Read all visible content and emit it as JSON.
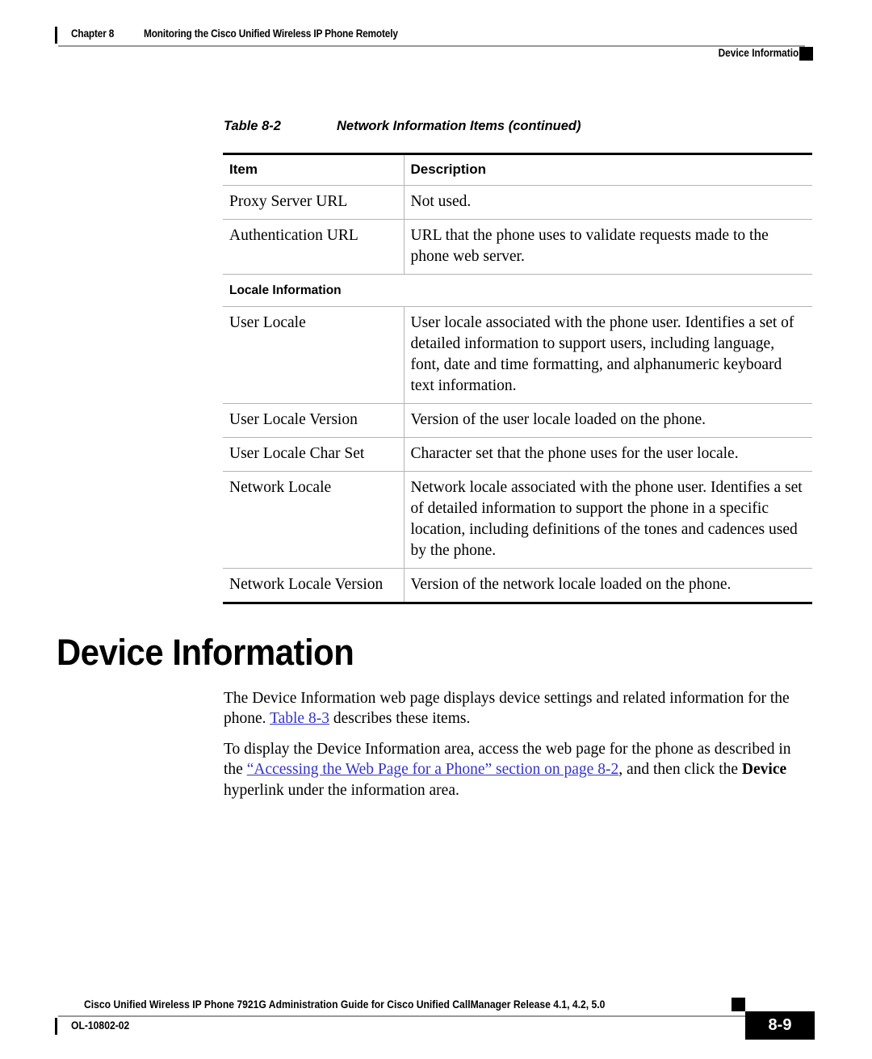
{
  "header": {
    "chapter_label": "Chapter 8",
    "chapter_title": "Monitoring the Cisco Unified Wireless IP Phone Remotely",
    "section_title": "Device Information"
  },
  "table": {
    "caption_number": "Table 8-2",
    "caption_title": "Network Information Items (continued)",
    "columns": [
      "Item",
      "Description"
    ],
    "rows": [
      {
        "type": "data",
        "item": "Proxy Server URL",
        "description": "Not used."
      },
      {
        "type": "data",
        "item": "Authentication URL",
        "description": "URL that the phone uses to validate requests made to the phone web server."
      },
      {
        "type": "subhead",
        "item": "Locale Information",
        "description": ""
      },
      {
        "type": "data",
        "item": "User Locale",
        "description": "User locale associated with the phone user. Identifies a set of detailed information to support users, including language, font, date and time formatting, and alphanumeric keyboard text information."
      },
      {
        "type": "data",
        "item": "User Locale Version",
        "description": "Version of the user locale loaded on the phone."
      },
      {
        "type": "data",
        "item": "User Locale Char Set",
        "description": "Character set that the phone uses for the user locale."
      },
      {
        "type": "data",
        "item": "Network Locale",
        "description": "Network locale associated with the phone user. Identifies a set of detailed information to support the phone in a specific location, including definitions of the tones and cadences used by the phone."
      },
      {
        "type": "data",
        "item": "Network Locale Version",
        "description": "Version of the network locale loaded on the phone."
      }
    ]
  },
  "section": {
    "heading": "Device Information",
    "paragraph1": {
      "part1": "The Device Information web page displays device settings and related information for the phone. ",
      "link1": "Table 8-3",
      "part2": " describes these items."
    },
    "paragraph2": {
      "part1": "To display the Device Information area, access the web page for the phone as described in the ",
      "link1": "“Accessing the Web Page for a Phone” section on page 8-2",
      "part2": ", and then click the ",
      "bold1": "Device",
      "part3": " hyperlink under the information area."
    }
  },
  "footer": {
    "guide_title": "Cisco Unified Wireless IP Phone 7921G Administration Guide for Cisco Unified CallManager Release 4.1, 4.2, 5.0",
    "doc_id": "OL-10802-02",
    "page_number": "8-9"
  },
  "colors": {
    "link": "#3333cc",
    "rule": "#999999",
    "table_rule": "#b4b4b4",
    "text": "#000000"
  }
}
